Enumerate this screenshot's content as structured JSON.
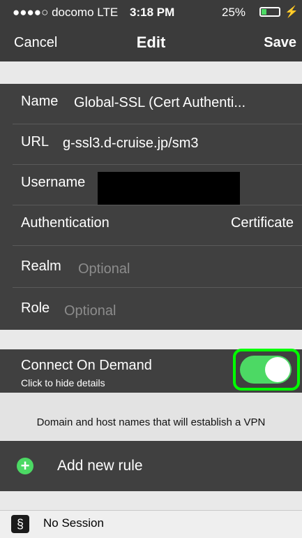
{
  "status_bar": {
    "carrier": "●●●●○ docomo  LTE",
    "time": "3:18 PM",
    "battery": "25%",
    "battery_level": 0.25
  },
  "nav": {
    "cancel_label": "Cancel",
    "title": "Edit",
    "save_label": "Save"
  },
  "form": {
    "name_label": "Name",
    "name_value": "Global-SSL (Cert Authenti...",
    "url_label": "URL",
    "url_value": "g-ssl3.d-cruise.jp/sm3",
    "username_label": "Username",
    "authentication_label": "Authentication",
    "authentication_value": "Certificate",
    "realm_label": "Realm",
    "realm_placeholder": "Optional",
    "role_label": "Role",
    "role_placeholder": "Optional"
  },
  "connect_on_demand": {
    "label": "Connect On Demand",
    "sublabel": "Click to hide details",
    "enabled": true,
    "description": "Domain and host names that will establish a VPN",
    "add_rule_label": "Add new rule"
  },
  "bottom_bar": {
    "session_text": "No Session"
  },
  "colors": {
    "toggle_on": "#4cd964",
    "highlight": "#00ff00",
    "dark_bg": "#404040"
  }
}
